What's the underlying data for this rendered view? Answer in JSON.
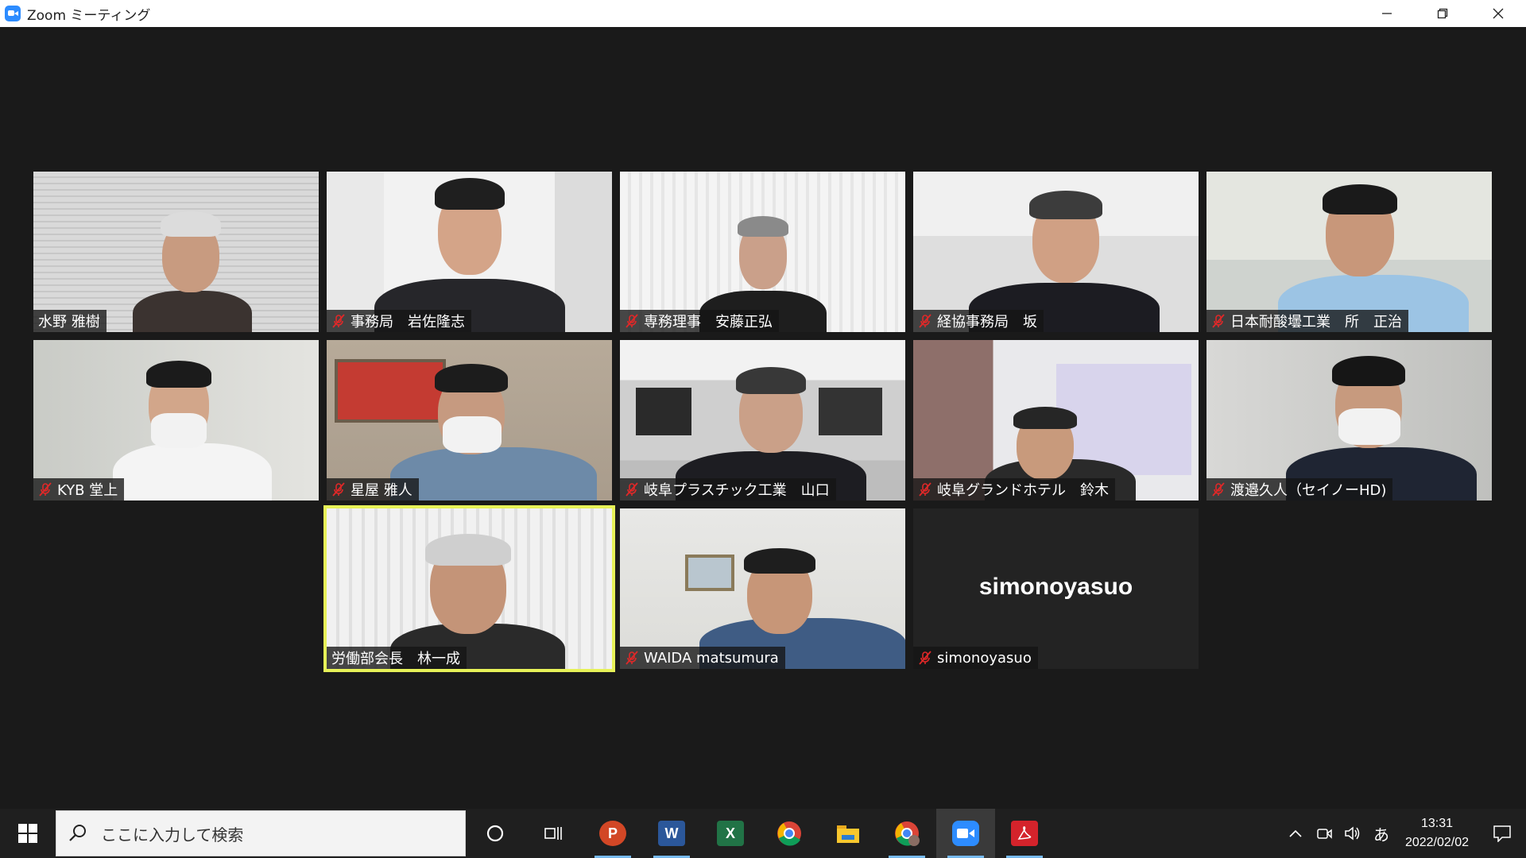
{
  "window": {
    "title": "Zoom ミーティング"
  },
  "participants": [
    {
      "name": "水野 雅樹",
      "muted": false
    },
    {
      "name": "事務局　岩佐隆志",
      "muted": true
    },
    {
      "name": "専務理事　安藤正弘",
      "muted": true
    },
    {
      "name": "経協事務局　坂",
      "muted": true
    },
    {
      "name": "日本耐酸壜工業　所　正治",
      "muted": true
    },
    {
      "name": "KYB 堂上",
      "muted": true
    },
    {
      "name": "星屋 雅人",
      "muted": true
    },
    {
      "name": "岐阜プラスチック工業　山口",
      "muted": true
    },
    {
      "name": "岐阜グランドホテル　鈴木",
      "muted": true
    },
    {
      "name": "渡邉久人（セイノーHD)",
      "muted": true
    },
    {
      "name": "労働部会長　林一成",
      "muted": false,
      "speaking": true
    },
    {
      "name": "WAIDA matsumura",
      "muted": true
    },
    {
      "name": "simonoyasuo",
      "muted": true,
      "camera_off": true,
      "display_name": "simonoyasuo"
    }
  ],
  "taskbar": {
    "search_placeholder": "ここに入力して検索",
    "apps": [
      "cortana-icon",
      "task-view-icon",
      "powerpoint-icon",
      "word-icon",
      "excel-icon",
      "chrome-icon",
      "file-explorer-icon",
      "chrome-profile-icon",
      "zoom-icon",
      "acrobat-icon"
    ],
    "ime": "あ",
    "time": "13:31",
    "date": "2022/02/02"
  },
  "colors": {
    "active_speaker_border": "#e7f258",
    "mute_icon": "#e02828",
    "meeting_bg": "#1a1a1a",
    "zoom_blue": "#2d8cff"
  }
}
